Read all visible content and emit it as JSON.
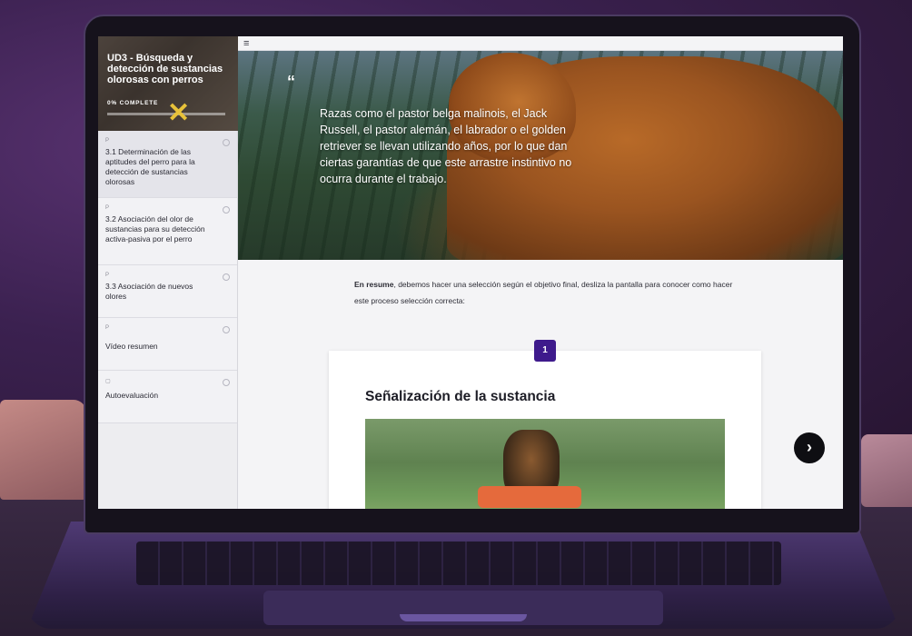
{
  "course": {
    "title": "UD3 - Búsqueda y detección de sustancias olorosas con perros",
    "progress_label": "0% COMPLETE",
    "progress": 0
  },
  "sidebar": {
    "items": [
      {
        "type": "P",
        "label": "3.1 Determinación de las aptitudes del perro para la detección de sustancias olorosas",
        "icon": "progress-ring-icon"
      },
      {
        "type": "P",
        "label": "3.2 Asociación del olor de sustancias para su detección activa-pasiva por el perro",
        "icon": "status-ring-icon"
      },
      {
        "type": "P",
        "label": "3.3 Asociación de nuevos olores",
        "icon": "status-ring-icon"
      },
      {
        "type": "P",
        "label": "Vídeo resumen",
        "icon": "status-ring-icon"
      },
      {
        "type": "▢",
        "label": "Autoevaluación",
        "icon": "status-ring-icon"
      }
    ]
  },
  "header": {
    "menu_icon": "hamburger-menu-icon"
  },
  "hero": {
    "quote_mark": "“",
    "quote": "Razas como el pastor belga malinois, el Jack Russell, el pastor alemán, el labrador o el golden retriever se llevan utilizando años, por lo que dan ciertas garantías de que este arrastre instintivo no ocurra durante el trabajo."
  },
  "summary": {
    "bold": "En resume",
    "text": ", debemos hacer una selección según el objetivo final, desliza la pantalla para conocer como hacer este proceso selección correcta:"
  },
  "step_card": {
    "number": "1",
    "title": "Señalización de la sustancia"
  },
  "next_button": {
    "glyph": "›",
    "icon": "chevron-right-icon"
  },
  "colors": {
    "accent": "#3e1a8c",
    "sidebar_bg": "#ededf0",
    "next_button": "#0e0e12",
    "progress_mark": "#e8c23a"
  }
}
